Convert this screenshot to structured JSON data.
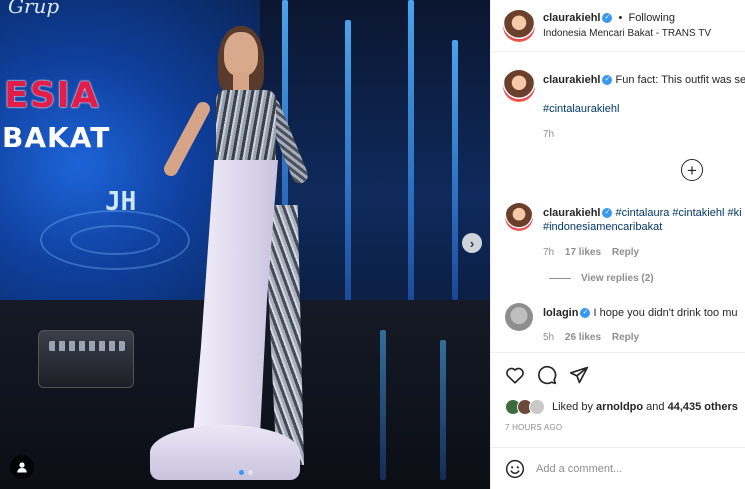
{
  "photo": {
    "sign_top": "Grup",
    "sign_line1": "ESIA",
    "sign_line2": "BAKAT",
    "logo_mark": "JH",
    "next_icon": "chevron-right-icon",
    "user_icon": "user-tag-icon",
    "carousel_dots": 2,
    "carousel_active": 0
  },
  "header": {
    "username": "claurakiehl",
    "separator": "•",
    "follow_state": "Following",
    "location": "Indonesia Mencari Bakat - TRANS TV"
  },
  "caption": {
    "username": "claurakiehl",
    "text": "Fun fact: This outfit was se",
    "hashtag": "#cintalaurakiehl",
    "time": "7h"
  },
  "load_more_icon": "plus-circle-icon",
  "comments": [
    {
      "username": "claurakiehl",
      "text_line1": "#cintalaura #cintakiehl #ki",
      "text_line2": "#indonesiamencaribakat",
      "time": "7h",
      "likes": "17 likes",
      "reply": "Reply",
      "view_replies": "View replies (2)"
    },
    {
      "username": "lolagin",
      "text_line1": "I hope you didn't drink too mu",
      "time": "5h",
      "likes": "26 likes",
      "reply": "Reply"
    }
  ],
  "actions": {
    "like_icon": "heart-icon",
    "comment_icon": "comment-icon",
    "share_icon": "share-icon",
    "liked_by_prefix": "Liked by",
    "liked_by_user": "arnoldpo",
    "liked_by_and": "and",
    "liked_by_count": "44,435 others",
    "timestamp": "7 HOURS AGO"
  },
  "composer": {
    "emoji_icon": "emoji-icon",
    "placeholder": "Add a comment..."
  },
  "colors": {
    "hashtag": "#00376b",
    "verified": "#3897f0",
    "muted": "#8e8e8e",
    "text": "#262626"
  }
}
